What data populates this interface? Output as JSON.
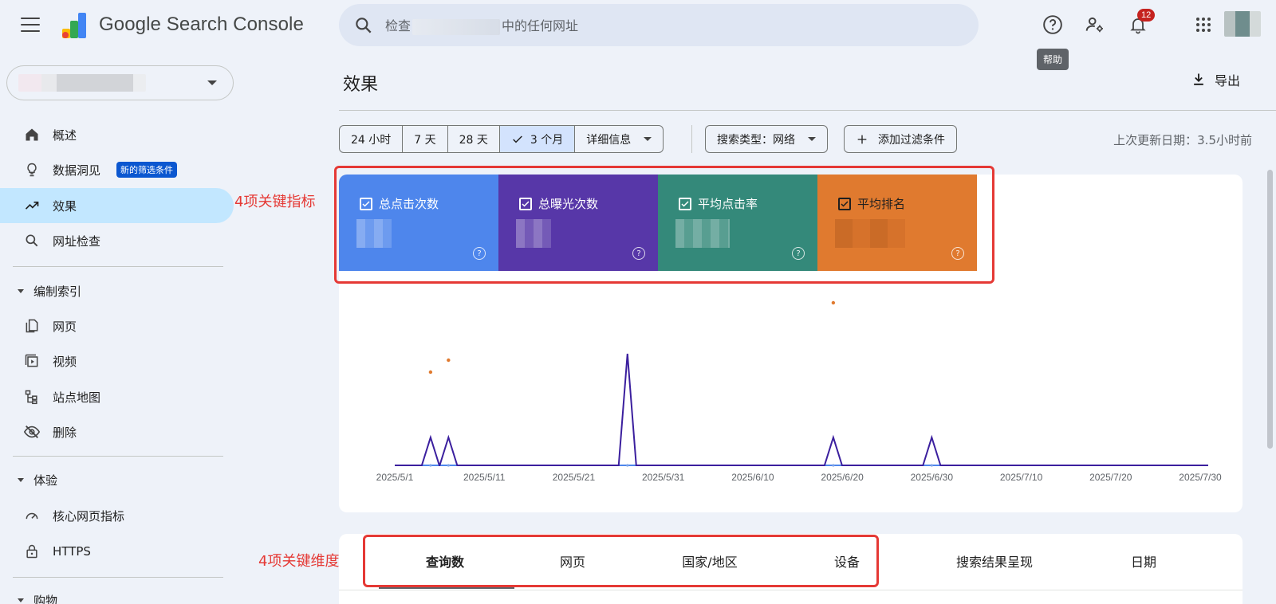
{
  "header": {
    "app_title": "Google Search Console",
    "search_placeholder_prefix": "检查",
    "search_placeholder_suffix": "中的任何网址",
    "notification_count": "12",
    "help_tooltip": "帮助"
  },
  "sidebar": {
    "items": [
      {
        "label": "概述",
        "icon": "home-icon"
      },
      {
        "label": "数据洞见",
        "icon": "lightbulb-icon",
        "badge": "新的筛选条件"
      },
      {
        "label": "效果",
        "icon": "trending-up-icon"
      },
      {
        "label": "网址检查",
        "icon": "search-icon"
      },
      {
        "label": "网页",
        "icon": "pages-icon"
      },
      {
        "label": "视频",
        "icon": "video-icon"
      },
      {
        "label": "站点地图",
        "icon": "sitemap-icon"
      },
      {
        "label": "删除",
        "icon": "visibility-off-icon"
      },
      {
        "label": "核心网页指标",
        "icon": "speed-icon"
      },
      {
        "label": "HTTPS",
        "icon": "lock-icon"
      }
    ],
    "sections": {
      "indexing": "编制索引",
      "experience": "体验",
      "shopping": "购物"
    }
  },
  "main": {
    "title": "效果",
    "export_label": "导出",
    "date_ranges": [
      "24 小时",
      "7 天",
      "28 天",
      "3 个月"
    ],
    "date_details": "详细信息",
    "search_type_filter": "搜索类型：网络",
    "add_filter": "添加过滤条件",
    "last_update": "上次更新日期：3.5小时前",
    "metrics": [
      {
        "label": "总点击次数",
        "color": "#4e86ec"
      },
      {
        "label": "总曝光次数",
        "color": "#5737a8"
      },
      {
        "label": "平均点击率",
        "color": "#34897a"
      },
      {
        "label": "平均排名",
        "color": "#e07a2f"
      }
    ],
    "dimension_tabs": [
      "查询数",
      "网页",
      "国家/地区",
      "设备",
      "搜索结果呈现",
      "日期"
    ]
  },
  "annotations": {
    "metrics_note": "4项关键指标",
    "dimensions_note": "4项关键维度"
  },
  "chart_data": {
    "type": "line",
    "x": [
      "2025/5/1",
      "2025/5/11",
      "2025/5/21",
      "2025/5/31",
      "2025/6/10",
      "2025/6/20",
      "2025/6/30",
      "2025/7/10",
      "2025/7/20",
      "2025/7/30"
    ],
    "series": [
      {
        "name": "总曝光次数",
        "color": "#3b1f9e",
        "peaks": [
          {
            "date": "2025/5/5",
            "value": 1
          },
          {
            "date": "2025/5/7",
            "value": 1
          },
          {
            "date": "2025/5/27",
            "value": 4
          },
          {
            "date": "2025/6/19",
            "value": 1
          },
          {
            "date": "2025/6/30",
            "value": 1
          }
        ]
      },
      {
        "name": "总点击次数",
        "color": "#4e86ec",
        "values": [
          0,
          0,
          0,
          0,
          0,
          0,
          0,
          0,
          0,
          0
        ]
      },
      {
        "name": "平均排名",
        "color": "#e07a2f",
        "points": [
          {
            "date": "2025/5/5"
          },
          {
            "date": "2025/5/7"
          },
          {
            "date": "2025/6/19"
          }
        ]
      }
    ]
  }
}
